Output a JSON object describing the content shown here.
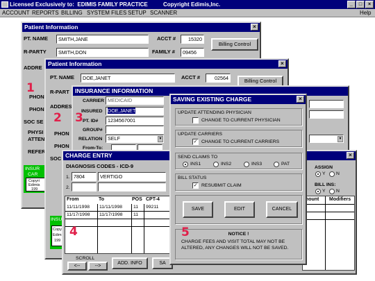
{
  "titlebar": {
    "title": "Licensed Exclusively to:  EDIMIS FAMILY PRACTICE          Copyright Edimis,Inc.",
    "min": "_",
    "max": "□",
    "close": "×"
  },
  "menu": {
    "items": [
      "ACCOUNT",
      "REPORTS",
      "BILLING",
      "SYSTEM FILES",
      "SETUP",
      "SCANNER"
    ],
    "help": "Help"
  },
  "patient1": {
    "title": "Patient Information",
    "pt_name_label": "PT. NAME",
    "pt_name": "SMITH,JANE",
    "acct_label": "ACCT #",
    "acct": "15320",
    "rparty_label": "R-PARTY",
    "rparty": "SMITH,DON",
    "family_label": "FAMILY #",
    "family": "09456",
    "billing_control": "Billing Control",
    "address_label": "ADDRE",
    "phone1": "PHON",
    "phone2": "PHON",
    "soc_label": "SOC SE",
    "physician_label": "PHYSI",
    "attending_label": "ATTEN",
    "referring_label": "REFER",
    "ins_label": "INSUR",
    "car_label": "CAR",
    "copy1": "Copyri",
    "edimis": "Edimis",
    "year": "199"
  },
  "patient2": {
    "title": "Patient Information",
    "pt_name_label": "PT. NAME",
    "pt_name": "DOE,JANET",
    "acct_label": "ACCT #",
    "acct": "02564",
    "billing_control": "Billing Control",
    "rparty_label": "R-PART",
    "address_label": "ADDRES",
    "phone1": "PHON",
    "phone2": "PHON",
    "soc_label": "SOC",
    "ins_label": "INSU",
    "copy1": "Copyri",
    "edimis": "Edim",
    "year": "199"
  },
  "insurance": {
    "title": "INSURANCE INFORMATION",
    "carrier_label": "CARRIER",
    "carrier": "MEDICAID",
    "insured_label": "INSURED",
    "insured": "DOE,JANET",
    "ptid_label": "PT. ID#",
    "ptid": "1234567001",
    "group_label": "GROUP#",
    "group": "",
    "relation_label": "RELATION",
    "relation": "SELF",
    "from_label": "From-To:"
  },
  "charge": {
    "title": "CHARGE ENTRY",
    "diag_label": "DIAGNOSIS CODES - ICD-9",
    "dx": [
      {
        "num": "1.",
        "code": "7804",
        "desc": "VERTIGO"
      },
      {
        "num": "2.",
        "code": "",
        "desc": ""
      }
    ],
    "headers": {
      "from": "From",
      "to": "To",
      "pos": "POS",
      "cpt": "CPT-4"
    },
    "rows": [
      {
        "from": "11/11/1998",
        "to": "11/11/1998",
        "pos": "11",
        "cpt": "99211"
      },
      {
        "from": "11/17/1998",
        "to": "11/17/1998",
        "pos": "11",
        "cpt": ""
      }
    ],
    "scroll_label": "SCROLL",
    "scroll_left": "<--",
    "scroll_right": "-->",
    "add_info": "ADD. INFO",
    "save_partial": "SA",
    "assign_label": "ASSIGN",
    "y1": "Y",
    "n1": "N",
    "bill_ins_label": "BILL INS:",
    "y2": "Y",
    "n2": "N",
    "amount_header": "mount",
    "modifiers_header": "Modifiers"
  },
  "saving": {
    "title": "SAVING EXISTING CHARGE",
    "update_physician_label": "UPDATE ATTENDING PHYSICIAN",
    "change_physician": "CHANGE TO CURRENT PHYSICIAN",
    "change_physician_checked": false,
    "update_carriers_label": "UPDATE CARRIERS",
    "change_carriers": "CHANGE TO CURRENT CARRIERS",
    "change_carriers_checked": true,
    "send_claims_label": "SEND CLAIMS TO",
    "ins_options": [
      "INS1",
      "INS2",
      "INS3",
      "PAT"
    ],
    "ins_selected": "INS1",
    "bill_status_label": "BILL STATUS",
    "resubmit": "RESUBMIT CLAIM",
    "resubmit_checked": true,
    "save": "SAVE",
    "edit": "EDIT",
    "cancel": "CANCEL",
    "notice_title": "NOTICE !",
    "notice_text": "CHARGE FEES AND VISIT TOTAL MAY NOT BE ALTERED, ANY CHANGES WILL NOT BE SAVED."
  },
  "markers": [
    "1",
    "2",
    "3",
    "4",
    "5"
  ],
  "colors": {
    "titlebar": "#00007b",
    "face": "#c0c0c0",
    "insurance_box": "#00c000",
    "marker": "#e0204a"
  }
}
